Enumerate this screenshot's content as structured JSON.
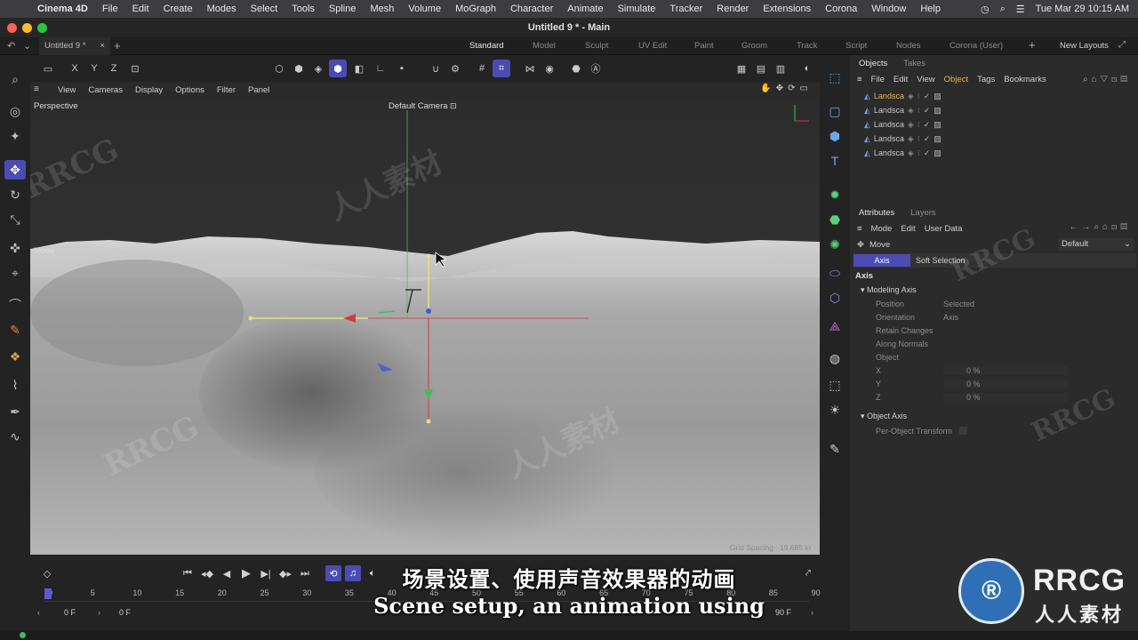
{
  "menubar": {
    "apple": "",
    "items": [
      "Cinema 4D",
      "File",
      "Edit",
      "Create",
      "Modes",
      "Select",
      "Tools",
      "Spline",
      "Mesh",
      "Volume",
      "MoGraph",
      "Character",
      "Animate",
      "Simulate",
      "Tracker",
      "Render",
      "Extensions",
      "Corona",
      "Window",
      "Help"
    ],
    "datetime": "Tue Mar 29  10:15 AM"
  },
  "window": {
    "title": "Untitled 9 * - Main"
  },
  "doc_tab": {
    "label": "Untitled 9 *"
  },
  "layouts": [
    "Standard",
    "Model",
    "Sculpt",
    "UV Edit",
    "Paint",
    "Groom",
    "Track",
    "Script",
    "Nodes",
    "Corona (User)"
  ],
  "new_layouts": "New Layouts",
  "axis_buttons": [
    "X",
    "Y",
    "Z"
  ],
  "viewport_menu": [
    "View",
    "Cameras",
    "Display",
    "Options",
    "Filter",
    "Panel"
  ],
  "viewport": {
    "name": "Perspective",
    "camera": "Default Camera",
    "move_label": "Move",
    "grid_spacing": "Grid Spacing : 19.685 in"
  },
  "objects_panel": {
    "tabs": [
      "Objects",
      "Takes"
    ],
    "menu": [
      "File",
      "Edit",
      "View",
      "Object",
      "Tags",
      "Bookmarks"
    ],
    "rows": [
      "Landsca",
      "Landsca",
      "Landsca",
      "Landsca",
      "Landsca"
    ]
  },
  "attributes_panel": {
    "tabs": [
      "Attributes",
      "Layers"
    ],
    "menu": [
      "Mode",
      "Edit",
      "User Data"
    ],
    "tool": "Move",
    "preset": "Default",
    "subtabs": [
      "Axis",
      "Soft Selection"
    ],
    "section": "Axis",
    "modeling_axis": "Modeling Axis",
    "fields": [
      {
        "label": "Position",
        "value": "Selected"
      },
      {
        "label": "Orientation",
        "value": "Axis"
      },
      {
        "label": "Retain Changes",
        "value": ""
      },
      {
        "label": "Along Normals",
        "value": ""
      },
      {
        "label": "Object",
        "value": ""
      },
      {
        "label": "X",
        "value": "0 %"
      },
      {
        "label": "Y",
        "value": "0 %"
      },
      {
        "label": "Z",
        "value": "0 %"
      }
    ],
    "object_axis": "Object Axis",
    "per_object": "Per-Object Transform"
  },
  "timeline": {
    "ticks": [
      "0",
      "5",
      "10",
      "15",
      "20",
      "25",
      "30",
      "35",
      "40",
      "45",
      "50",
      "55",
      "60",
      "65",
      "70",
      "75",
      "80",
      "85",
      "90"
    ],
    "start_frame": "0 F",
    "current_frame": "0 F",
    "end_frame": "90 F"
  },
  "subtitles": {
    "cn": "场景设置、使用声音效果器的动画",
    "en": "Scene setup, an animation using"
  },
  "watermark": {
    "brand": "RRCG",
    "brand_cn": "人人素材"
  },
  "colors": {
    "accent": "#5a5ccf",
    "x_axis": "#d43a3a",
    "y_axis": "#3fbf5a",
    "z_axis": "#3a5bd4",
    "highlight": "#e6b84a"
  }
}
